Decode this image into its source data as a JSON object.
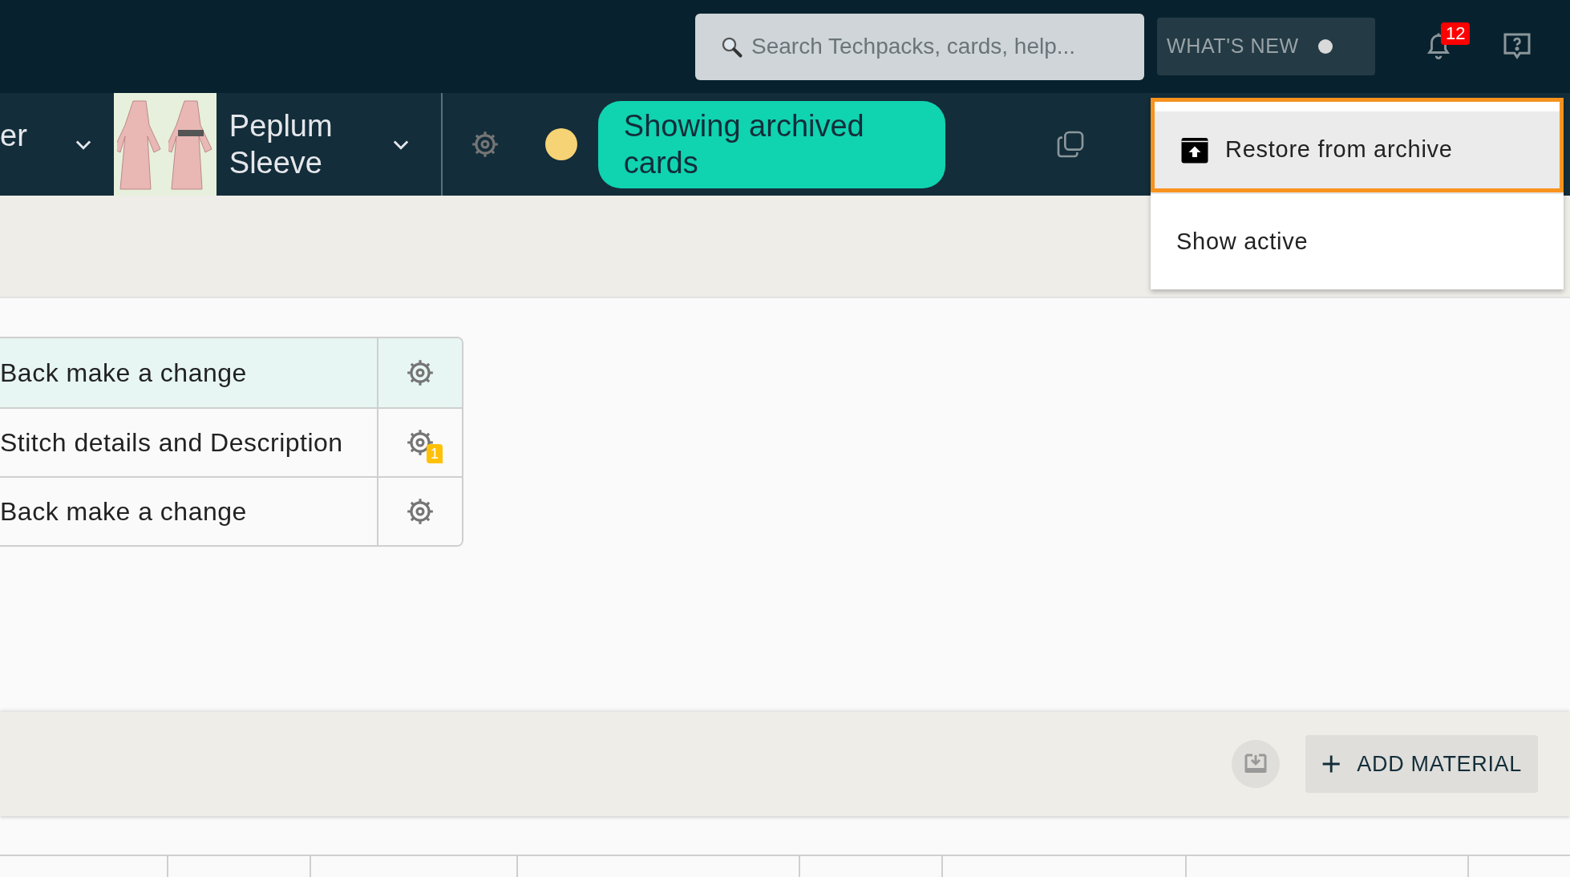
{
  "top_bar": {
    "search": {
      "placeholder": "Search Techpacks, cards, help..."
    },
    "whats_new": {
      "label": "WHAT'S NEW",
      "unread": true
    },
    "notifications": {
      "count": "12"
    }
  },
  "context_bar": {
    "previous_item": "er",
    "product": {
      "name": "Peplum Sleeve"
    },
    "status_pill": "Showing archived cards"
  },
  "menu": {
    "items": [
      {
        "kind": "icon",
        "label": "Restore from archive",
        "selected": true
      },
      {
        "kind": "plain",
        "label": "Show active",
        "selected": false
      }
    ]
  },
  "cards": [
    {
      "title": "Back make a change",
      "selected": true
    },
    {
      "title": "Stitch details and Description",
      "selected": false,
      "comments": "1"
    },
    {
      "title": "Back make a change",
      "selected": false
    }
  ],
  "materials": {
    "add_button": "ADD MATERIAL"
  }
}
